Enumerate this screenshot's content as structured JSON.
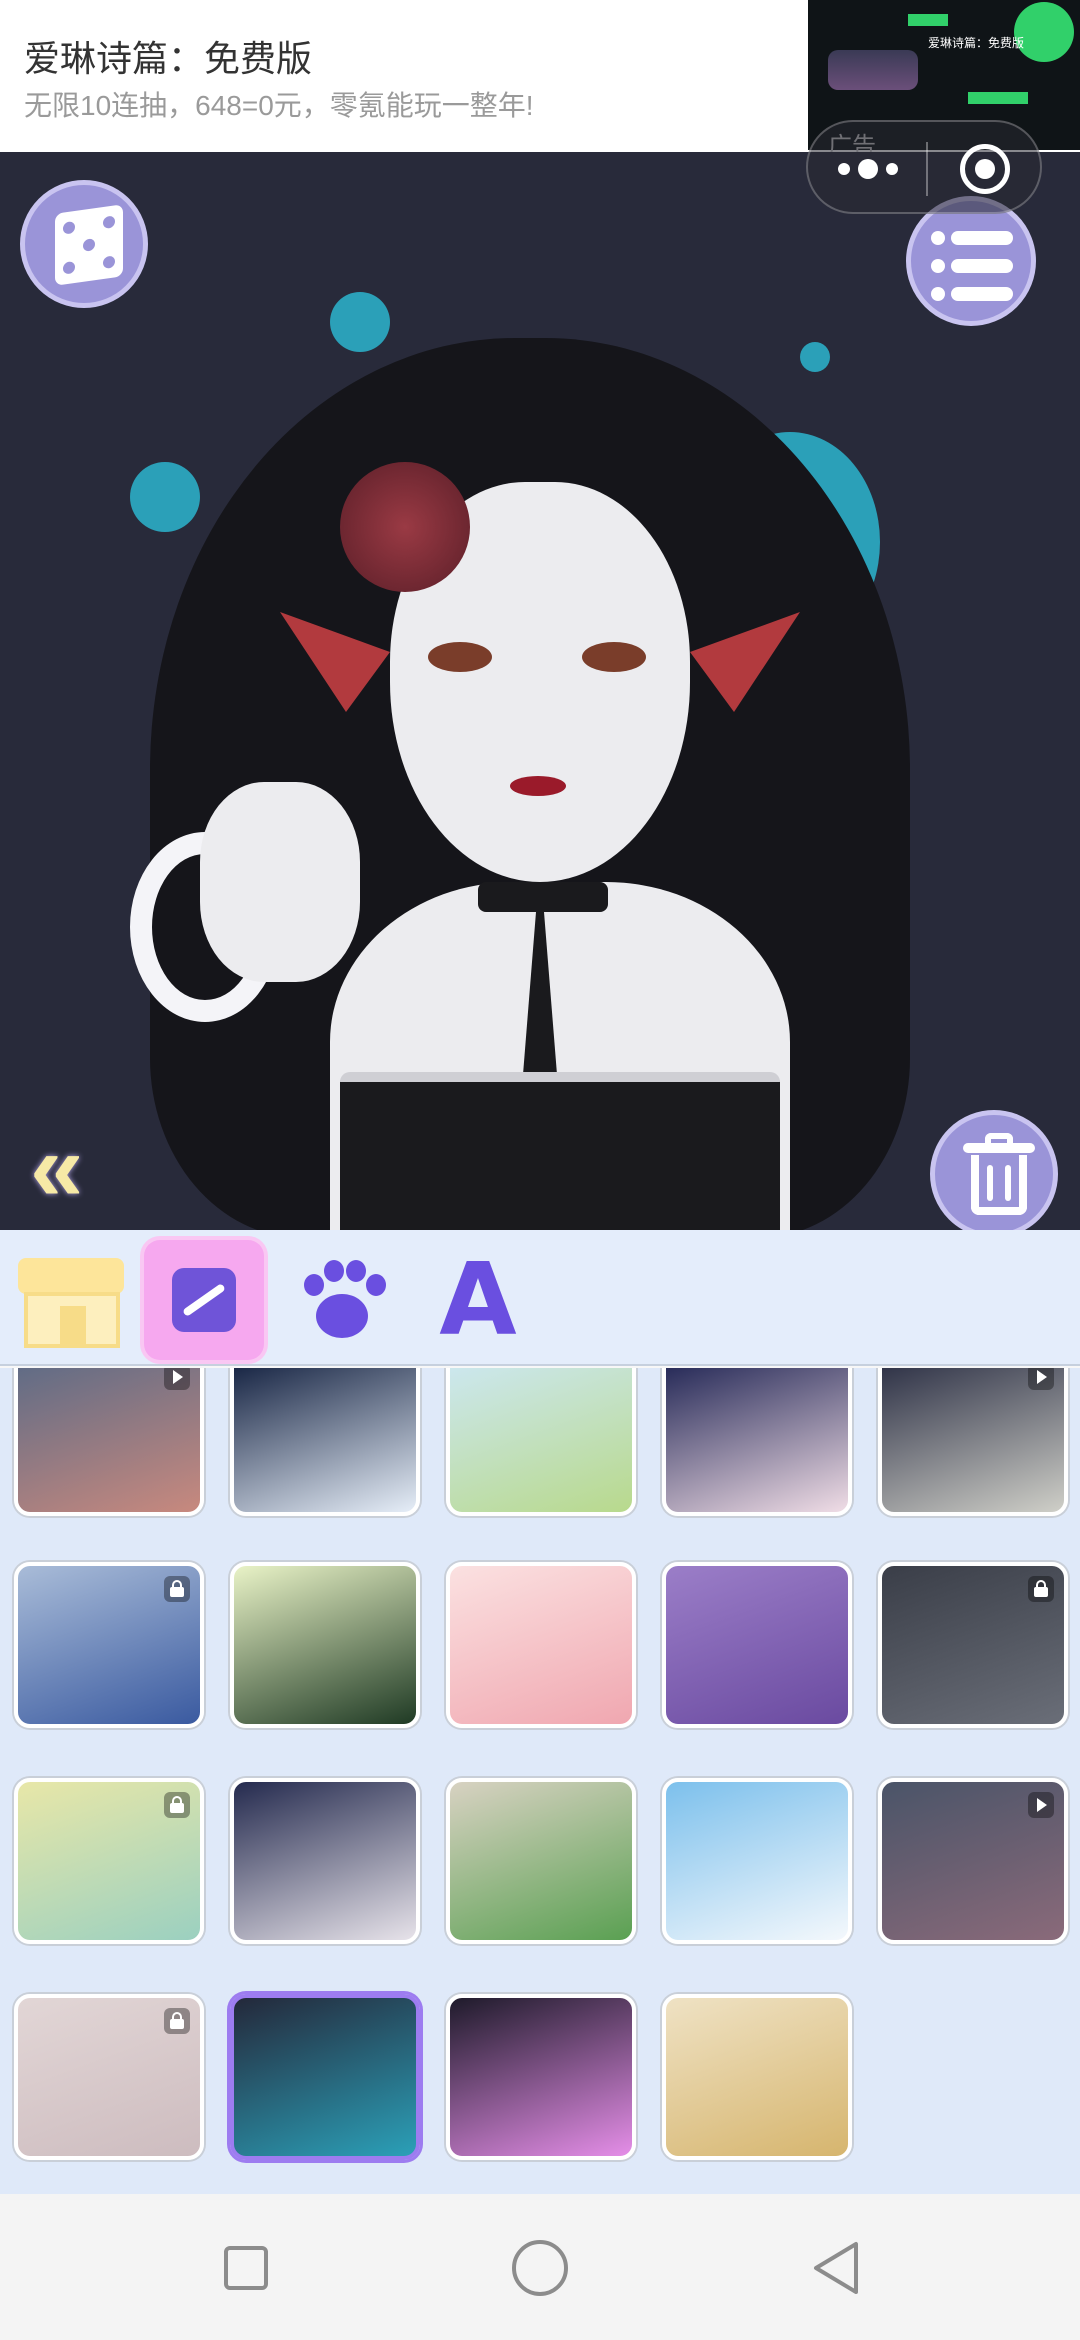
{
  "ad": {
    "title": "爱琳诗篇：免费版",
    "subtitle": "无限10连抽，648=0元，零氪能玩一整年!",
    "label": "广告",
    "thumb_caption": "爱琳诗篇：免费版"
  },
  "capsule": {
    "more_icon": "more-dots-icon",
    "close_icon": "close-target-icon"
  },
  "stage": {
    "background_color": "#282a3a",
    "splash_color": "#2ba0b8",
    "buttons": {
      "random": "dice-icon",
      "menu": "list-menu-icon",
      "delete": "trash-icon",
      "collapse": "«"
    }
  },
  "tabs": [
    {
      "name": "shop",
      "icon": "store-icon",
      "selected": false
    },
    {
      "name": "background",
      "icon": "picture-icon",
      "selected": true
    },
    {
      "name": "pet",
      "icon": "paw-icon",
      "selected": false
    },
    {
      "name": "text",
      "label": "A",
      "icon": "text-icon",
      "selected": false
    }
  ],
  "backgrounds": [
    {
      "theme": "dusk-clouds",
      "badge": "video",
      "selected": false,
      "colors": [
        "#5a6a86",
        "#c8897e"
      ]
    },
    {
      "theme": "full-moon",
      "badge": "",
      "selected": false,
      "colors": [
        "#0c1a3a",
        "#e6eef8"
      ]
    },
    {
      "theme": "lotus-pond",
      "badge": "",
      "selected": false,
      "colors": [
        "#cde8f4",
        "#b8d98c"
      ]
    },
    {
      "theme": "moon-starry",
      "badge": "",
      "selected": false,
      "colors": [
        "#1b2050",
        "#f0dde6"
      ]
    },
    {
      "theme": "gray-moon",
      "badge": "video",
      "selected": false,
      "colors": [
        "#262a40",
        "#cfcfc8"
      ]
    },
    {
      "theme": "blue-forest",
      "badge": "lock",
      "selected": false,
      "colors": [
        "#a9bcd8",
        "#3a5aa0"
      ]
    },
    {
      "theme": "green-mountains",
      "badge": "",
      "selected": false,
      "colors": [
        "#e9f3c7",
        "#1f3a24"
      ]
    },
    {
      "theme": "pink-dice",
      "badge": "",
      "selected": false,
      "colors": [
        "#fbe1e1",
        "#f0a7b0"
      ]
    },
    {
      "theme": "purple-clouds",
      "badge": "",
      "selected": false,
      "colors": [
        "#9b7ec8",
        "#6a4aa0"
      ]
    },
    {
      "theme": "spider-web",
      "badge": "lock",
      "selected": false,
      "colors": [
        "#3a3e48",
        "#6a6e78"
      ]
    },
    {
      "theme": "golden-koi",
      "badge": "lock",
      "selected": false,
      "colors": [
        "#e8e7a8",
        "#9bd0c0"
      ]
    },
    {
      "theme": "night-waves",
      "badge": "",
      "selected": false,
      "colors": [
        "#242a4e",
        "#e7e3ea"
      ]
    },
    {
      "theme": "vine-wall",
      "badge": "",
      "selected": false,
      "colors": [
        "#d8d2c2",
        "#5aa052"
      ]
    },
    {
      "theme": "sky-clouds",
      "badge": "",
      "selected": false,
      "colors": [
        "#7cc0ec",
        "#f4f8fc"
      ]
    },
    {
      "theme": "dusk-blur",
      "badge": "video",
      "selected": false,
      "colors": [
        "#4a5468",
        "#8a6a7a"
      ]
    },
    {
      "theme": "pink-lace",
      "badge": "lock",
      "selected": false,
      "colors": [
        "#e2d6d6",
        "#cdbcbf"
      ]
    },
    {
      "theme": "teal-splash",
      "badge": "",
      "selected": true,
      "colors": [
        "#24283a",
        "#2ba0b8"
      ]
    },
    {
      "theme": "bubbles",
      "badge": "",
      "selected": false,
      "colors": [
        "#1e1a2a",
        "#e58ee8"
      ]
    },
    {
      "theme": "folding-fans",
      "badge": "",
      "selected": false,
      "colors": [
        "#efe2c4",
        "#d6b56e"
      ]
    }
  ],
  "navbar": {
    "recent": "square-icon",
    "home": "circle-icon",
    "back": "triangle-back-icon"
  }
}
